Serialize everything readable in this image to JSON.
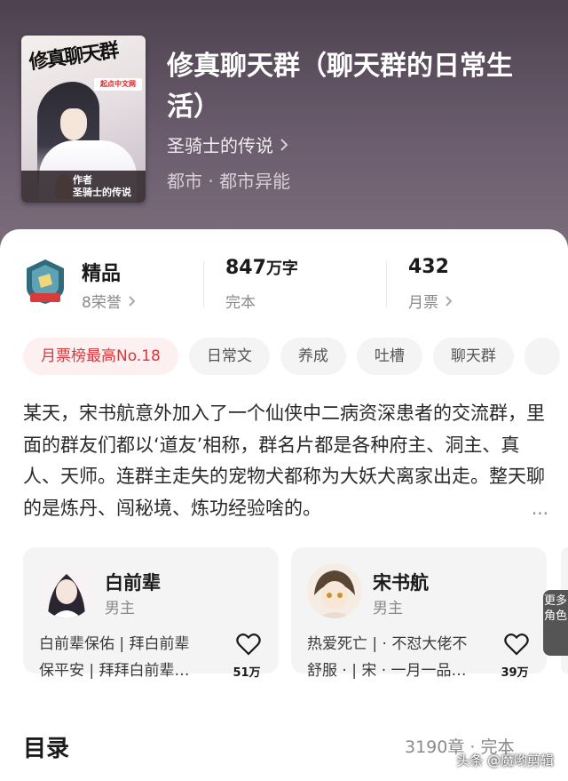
{
  "book": {
    "cover": {
      "title_art": "修真聊天群",
      "badge": "起点中文网",
      "author_label": "作者",
      "author_name": "圣骑士的传说"
    },
    "title": "修真聊天群（聊天群的日常生活）",
    "author": "圣骑士的传说",
    "genre": "都市 · 都市异能"
  },
  "stats": {
    "honor": {
      "label": "精品",
      "sub": "8荣誉",
      "icon": "honor-shield-icon"
    },
    "words": {
      "value": "847",
      "unit": "万字",
      "sub": "完本"
    },
    "tickets": {
      "value": "432",
      "sub": "月票"
    }
  },
  "tags": [
    "月票榜最高No.18",
    "日常文",
    "养成",
    "吐槽",
    "聊天群"
  ],
  "description": "某天，宋书航意外加入了一个仙侠中二病资深患者的交流群，里面的群友们都以‘道友’相称，群名片都是各种府主、洞主、真人、天师。连群主走失的宠物犬都称为大妖犬离家出走。整天聊的是炼丹、闯秘境、炼功经验啥的。",
  "description_more": "...",
  "characters": [
    {
      "name": "白前辈",
      "role": "男主",
      "tags_line1": "白前辈保佑 | 拜白前辈",
      "tags_line2": "保平安 | 拜拜白前辈…",
      "likes": "51万"
    },
    {
      "name": "宋书航",
      "role": "男主",
      "tags_line1": "热爱死亡 | · 不怼大佬不",
      "tags_line2": "舒服 · | 宋 · 一月一品…",
      "likes": "39万"
    }
  ],
  "more_roles": "更多角色",
  "toc": {
    "title": "目录",
    "meta": "3190章 · 完本"
  },
  "watermark": "头条 @魔哟剪辑",
  "colors": {
    "header_top": "#4d4150",
    "rank_tag_text": "#d9373c",
    "rank_tag_bg": "#fdf0f0"
  }
}
